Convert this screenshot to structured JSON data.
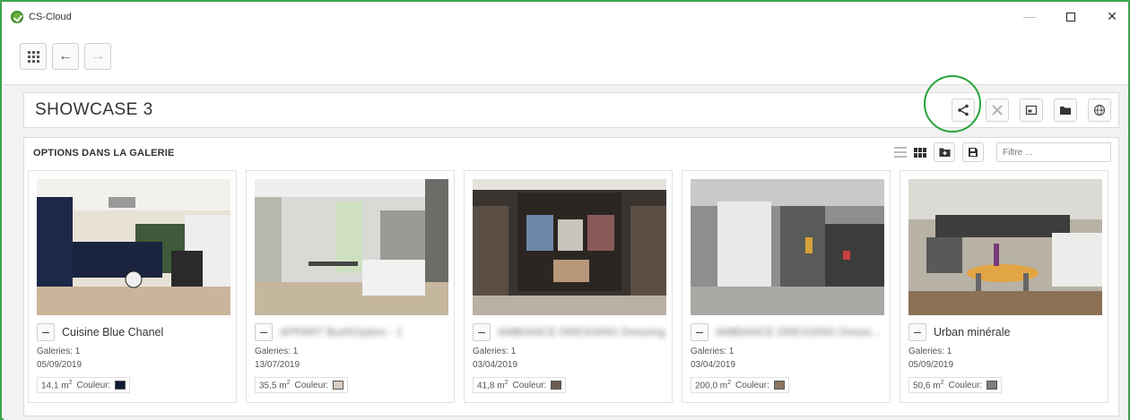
{
  "window": {
    "title": "CS-Cloud",
    "minimize": "—",
    "close": "✕"
  },
  "toolbar": {
    "back_glyph": "←",
    "forward_glyph": "→"
  },
  "header": {
    "title": "SHOWCASE 3"
  },
  "gallery": {
    "title": "OPTIONS DANS LA GALERIE",
    "filter_placeholder": "Filtre ...",
    "cards": [
      {
        "name": "Cuisine Blue Chanel",
        "name_blurred": false,
        "galleries": "Galeries: 1",
        "date": "05/09/2019",
        "size": "14,1 m",
        "size_unit_sup": "2",
        "color_label": "Couleur:",
        "color": "#0f1a33",
        "image": "kitchen-blue"
      },
      {
        "name": "APPART BurthOption - 1",
        "name_blurred": true,
        "galleries": "Galeries: 1",
        "date": "13/07/2019",
        "size": "35,5 m",
        "size_unit_sup": "2",
        "color_label": "Couleur:",
        "color": "#d9ccc0",
        "image": "kitchen-white"
      },
      {
        "name": "AMBIANCE DRESSING Dressing",
        "name_blurred": true,
        "galleries": "Galeries: 1",
        "date": "03/04/2019",
        "size": "41,8 m",
        "size_unit_sup": "2",
        "color_label": "Couleur:",
        "color": "#6b5c50",
        "image": "dressing"
      },
      {
        "name": "AMBIANCE DRESSING Dressi...",
        "name_blurred": true,
        "galleries": "Galeries: 1",
        "date": "03/04/2019",
        "size": "200,0 m",
        "size_unit_sup": "2",
        "color_label": "Couleur:",
        "color": "#8a7561",
        "image": "hallway"
      },
      {
        "name": "Urban minérale",
        "name_blurred": false,
        "galleries": "Galeries: 1",
        "date": "05/09/2019",
        "size": "50,6 m",
        "size_unit_sup": "2",
        "color_label": "Couleur:",
        "color": "#7d7d7d",
        "image": "kitchen-dining"
      }
    ]
  },
  "colors": {
    "window_border": "#3fa34d",
    "highlight_circle": "#27a338"
  }
}
